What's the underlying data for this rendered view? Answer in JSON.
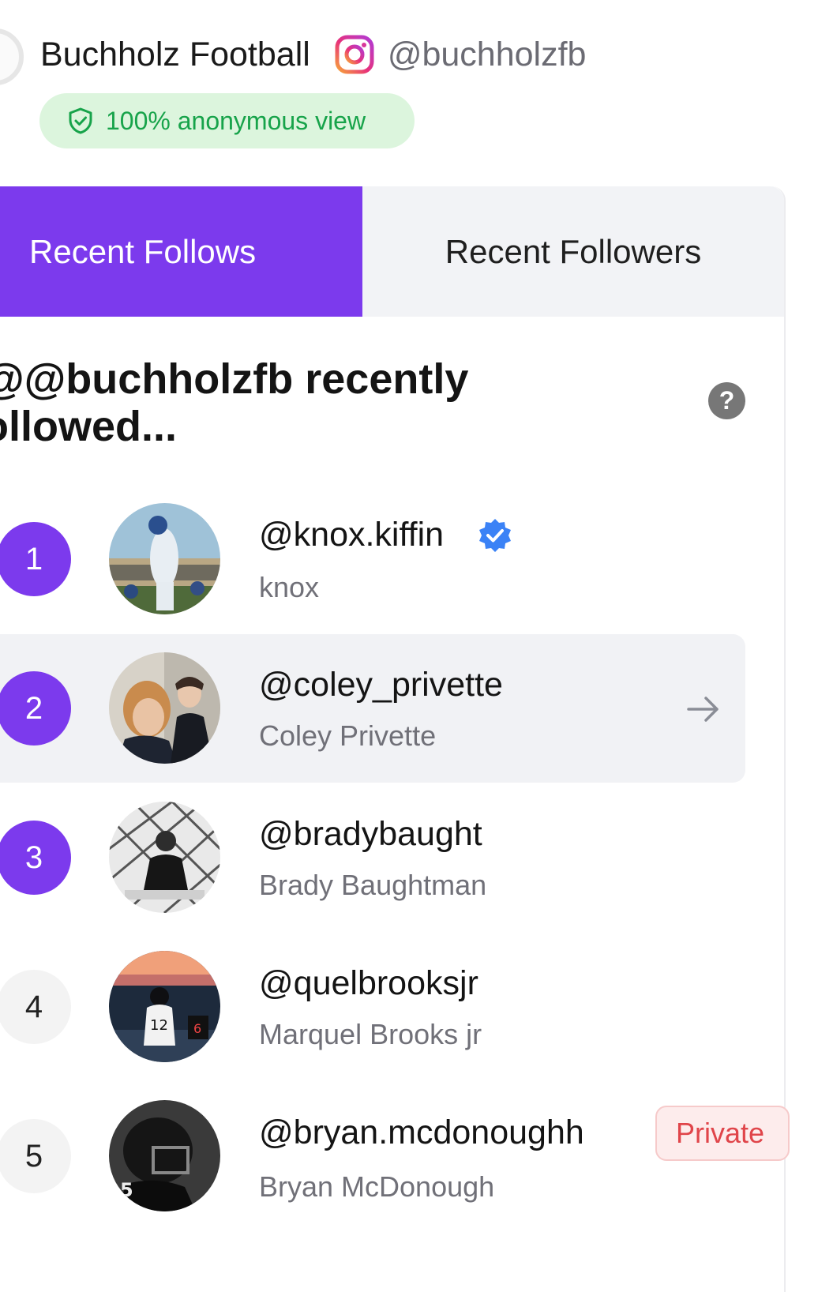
{
  "header": {
    "account_name": "Buchholz Football",
    "handle": "@buchholzfb",
    "anon_badge": "100% anonymous view"
  },
  "tabs": [
    {
      "label": "Recent Follows",
      "active": true
    },
    {
      "label": "Recent Followers",
      "active": false
    }
  ],
  "section": {
    "title_line1": "@@buchholzfb recently",
    "title_line2": "ollowed..."
  },
  "list": [
    {
      "rank": "1",
      "username": "@knox.kiffin",
      "name": "knox",
      "verified": true
    },
    {
      "rank": "2",
      "username": "@coley_privette",
      "name": "Coley Privette"
    },
    {
      "rank": "3",
      "username": "@bradybaught",
      "name": "Brady Baughtman"
    },
    {
      "rank": "4",
      "username": "@quelbrooksjr",
      "name": "Marquel Brooks jr"
    },
    {
      "rank": "5",
      "username": "@bryan.mcdonoughh",
      "name": "Bryan McDonough",
      "badge": "Private"
    }
  ],
  "colors": {
    "accent": "#7c3aed",
    "anon_green": "#17a34a",
    "verified_blue": "#3b82f6",
    "private_red": "#e0454a"
  },
  "icons": [
    "instagram-icon",
    "shield-check-icon",
    "help-icon",
    "verified-badge-icon",
    "arrow-right-icon"
  ]
}
